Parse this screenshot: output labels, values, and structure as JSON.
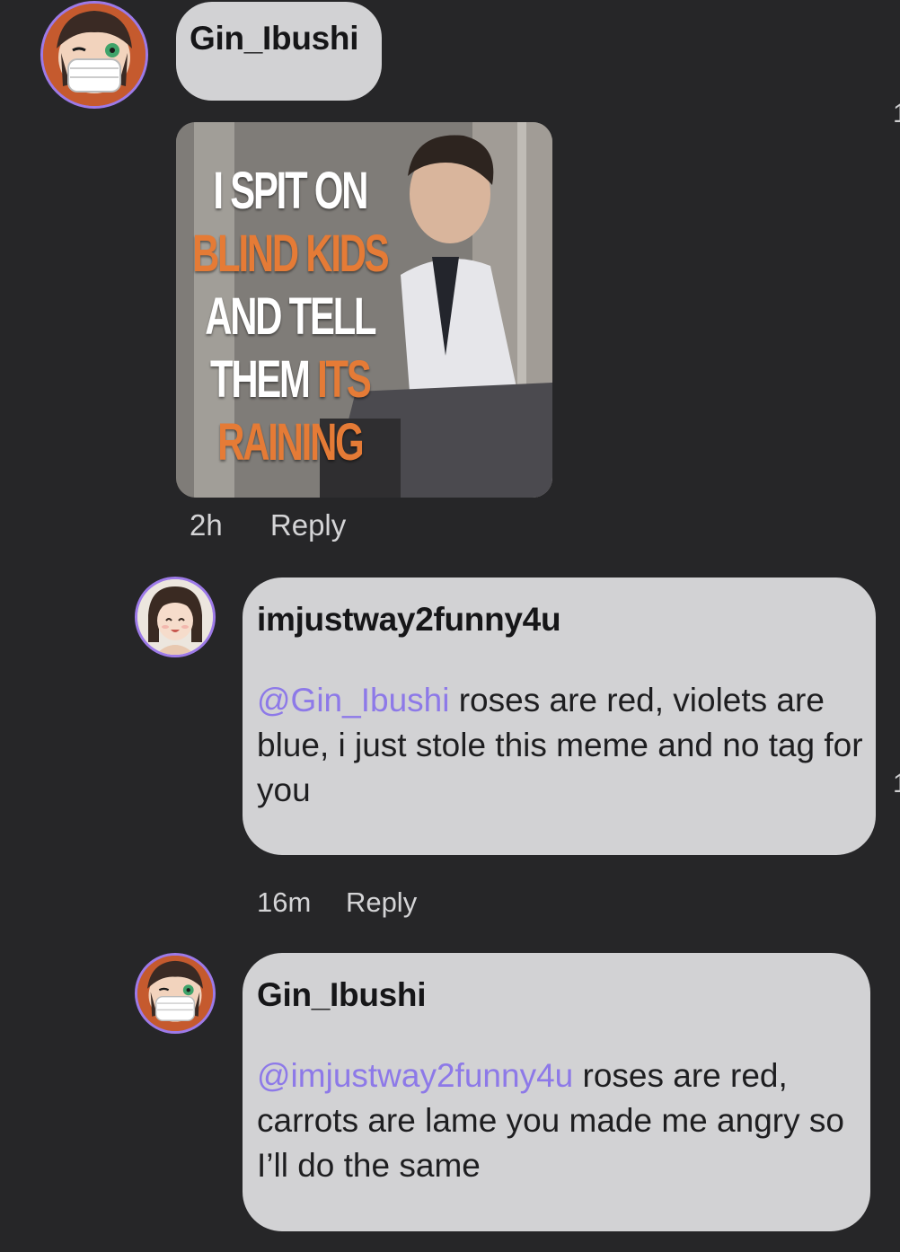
{
  "comments": [
    {
      "author": "Gin_Ibushi",
      "meme": {
        "lines": [
          [
            {
              "t": "I SPIT ON",
              "c": "white"
            }
          ],
          [
            {
              "t": "BLIND KIDS",
              "c": "orange"
            }
          ],
          [
            {
              "t": "AND TELL",
              "c": "white"
            }
          ],
          [
            {
              "t": "THEM ",
              "c": "white"
            },
            {
              "t": "ITS",
              "c": "orange"
            }
          ],
          [
            {
              "t": "RAINING",
              "c": "orange"
            }
          ]
        ]
      },
      "time": "2h",
      "reply_label": "Reply"
    },
    {
      "author": "imjustway2funny4u",
      "mention": "@Gin_Ibushi",
      "text": " roses are red, violets are blue, i just stole this meme and no tag for you",
      "time": "16m",
      "reply_label": "Reply"
    },
    {
      "author": "Gin_Ibushi",
      "mention": "@imjustway2funny4u",
      "text": " roses are red, carrots are lame you made me angry so I’ll do the same"
    }
  ],
  "edge_marks": [
    "1",
    "1"
  ],
  "colors": {
    "background": "#262628",
    "bubble": "#d2d2d4",
    "mention": "#8d79e8",
    "avatar_ring": "#9d7ae8",
    "meme_orange": "#e57b36"
  },
  "icons": {
    "avatar_gin": "masked-anime-avatar",
    "avatar_imjust": "smiling-anime-girl-avatar"
  }
}
